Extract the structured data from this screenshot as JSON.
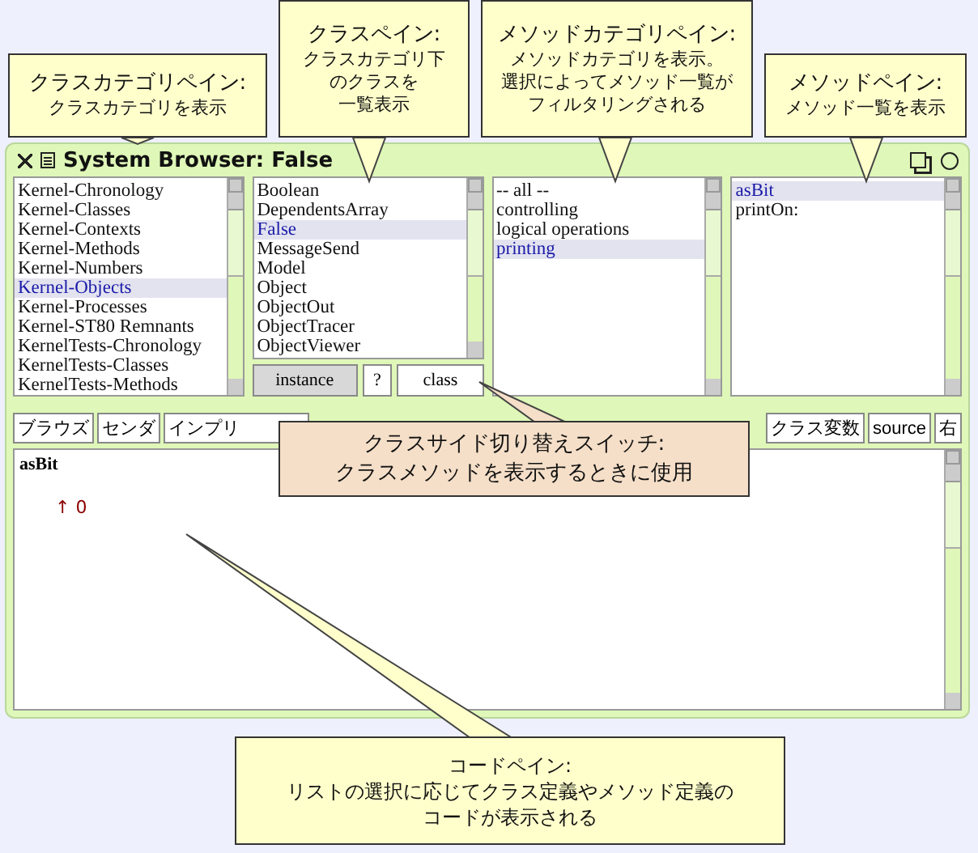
{
  "window": {
    "title": "System Browser: False"
  },
  "panes": [
    {
      "items": [
        {
          "label": "Kernel-Chronology",
          "selected": false
        },
        {
          "label": "Kernel-Classes",
          "selected": false
        },
        {
          "label": "Kernel-Contexts",
          "selected": false
        },
        {
          "label": "Kernel-Methods",
          "selected": false
        },
        {
          "label": "Kernel-Numbers",
          "selected": false
        },
        {
          "label": "Kernel-Objects",
          "selected": true
        },
        {
          "label": "Kernel-Processes",
          "selected": false
        },
        {
          "label": "Kernel-ST80 Remnants",
          "selected": false
        },
        {
          "label": "KernelTests-Chronology",
          "selected": false
        },
        {
          "label": "KernelTests-Classes",
          "selected": false
        },
        {
          "label": "KernelTests-Methods",
          "selected": false
        }
      ]
    },
    {
      "items": [
        {
          "label": "Boolean",
          "selected": false
        },
        {
          "label": "DependentsArray",
          "selected": false
        },
        {
          "label": "False",
          "selected": true
        },
        {
          "label": "MessageSend",
          "selected": false
        },
        {
          "label": "Model",
          "selected": false
        },
        {
          "label": "Object",
          "selected": false
        },
        {
          "label": "ObjectOut",
          "selected": false
        },
        {
          "label": "ObjectTracer",
          "selected": false
        },
        {
          "label": "ObjectViewer",
          "selected": false
        }
      ],
      "switch": [
        {
          "label": "instance",
          "selected": true
        },
        {
          "label": "?",
          "selected": false
        },
        {
          "label": "class",
          "selected": false
        }
      ]
    },
    {
      "items": [
        {
          "label": "-- all --",
          "selected": false
        },
        {
          "label": "controlling",
          "selected": false
        },
        {
          "label": "logical operations",
          "selected": false
        },
        {
          "label": "printing",
          "selected": true
        }
      ]
    },
    {
      "items": [
        {
          "label": "asBit",
          "selected": true
        },
        {
          "label": "printOn:",
          "selected": false
        }
      ]
    }
  ],
  "toolbar": {
    "left": [
      {
        "label": "ブラウズ"
      },
      {
        "label": "センダ"
      },
      {
        "label": "インプリ"
      }
    ],
    "right": [
      {
        "label": "クラス変数"
      },
      {
        "label": "source"
      },
      {
        "label": "右"
      }
    ]
  },
  "code": {
    "selector": "asBit",
    "body": "↑ 0"
  },
  "callouts": [
    {
      "kind": "top",
      "title": "クラスカテゴリペイン:",
      "lines": [
        "クラスカテゴリを表示"
      ],
      "color": "#ffffcc"
    },
    {
      "kind": "top",
      "title": "クラスペイン:",
      "lines": [
        "クラスカテゴリ下",
        "のクラスを",
        "一覧表示"
      ],
      "color": "#ffffcc"
    },
    {
      "kind": "top",
      "title": "メソッドカテゴリペイン:",
      "lines": [
        "メソッドカテゴリを表示。",
        "選択によってメソッド一覧が",
        "フィルタリングされる"
      ],
      "color": "#ffffcc"
    },
    {
      "kind": "top",
      "title": "メソッドペイン:",
      "lines": [
        "メソッド一覧を表示"
      ],
      "color": "#ffffcc"
    },
    {
      "kind": "middle",
      "title": "クラスサイド切り替えスイッチ:",
      "lines": [
        "クラスメソッドを表示するときに使用"
      ],
      "color": "#f5dfc8"
    },
    {
      "kind": "bottom",
      "title": "コードペイン:",
      "lines": [
        "リストの選択に応じてクラス定義やメソッド定義の",
        "コードが表示される"
      ],
      "color": "#ffffcc"
    }
  ]
}
